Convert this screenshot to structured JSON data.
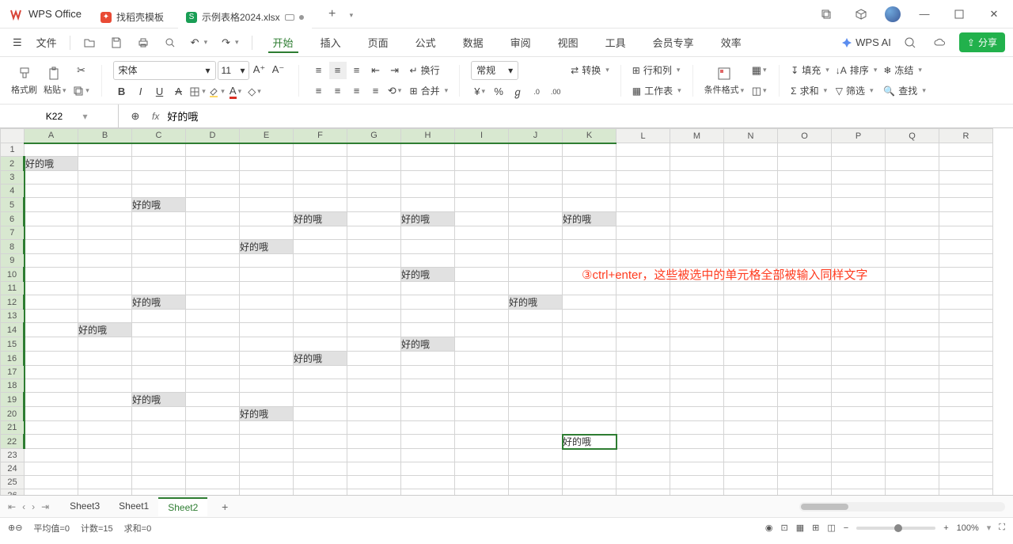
{
  "app": {
    "name": "WPS Office"
  },
  "tabs": {
    "template": "找稻壳模板",
    "file": "示例表格2024.xlsx"
  },
  "menu": {
    "file": "文件",
    "items": [
      "开始",
      "插入",
      "页面",
      "公式",
      "数据",
      "审阅",
      "视图",
      "工具",
      "会员专享",
      "效率"
    ],
    "wps_ai": "WPS AI",
    "share": "分享"
  },
  "ribbon": {
    "format_painter": "格式刷",
    "paste": "粘贴",
    "font": "宋体",
    "size": "11",
    "number_format": "常规",
    "wrap": "换行",
    "merge": "合并",
    "convert": "转换",
    "rowcol": "行和列",
    "worksheet": "工作表",
    "cond_format": "条件格式",
    "fill": "填充",
    "sort": "排序",
    "freeze": "冻结",
    "sum": "求和",
    "filter": "筛选",
    "find": "查找"
  },
  "formula_bar": {
    "cell_ref": "K22",
    "value": "好的哦"
  },
  "columns": [
    "A",
    "B",
    "C",
    "D",
    "E",
    "F",
    "G",
    "H",
    "I",
    "J",
    "K",
    "L",
    "M",
    "N",
    "O",
    "P",
    "Q",
    "R"
  ],
  "selected_cols": [
    "A",
    "B",
    "C",
    "D",
    "E",
    "F",
    "G",
    "H",
    "I",
    "J",
    "K"
  ],
  "selected_rows": [
    2,
    3,
    4,
    5,
    6,
    7,
    8,
    9,
    10,
    11,
    12,
    13,
    14,
    15,
    16,
    17,
    18,
    19,
    20,
    21,
    22
  ],
  "active_cell": "K22",
  "cells": {
    "A2": "好的哦",
    "C5": "好的哦",
    "F6": "好的哦",
    "H6": "好的哦",
    "K6": "好的哦",
    "E8": "好的哦",
    "H10": "好的哦",
    "C12": "好的哦",
    "J12": "好的哦",
    "B14": "好的哦",
    "H15": "好的哦",
    "F16": "好的哦",
    "C19": "好的哦",
    "E20": "好的哦",
    "K22": "好的哦"
  },
  "sel_mark_rows": [
    2,
    5,
    6,
    8,
    10,
    12,
    14,
    15,
    16,
    19,
    20,
    22
  ],
  "annotation": "③ctrl+enter，这些被选中的单元格全部被输入同样文字",
  "sheets": {
    "list": [
      "Sheet3",
      "Sheet1",
      "Sheet2"
    ],
    "active": "Sheet2"
  },
  "statusbar": {
    "avg": "平均值=0",
    "count": "计数=15",
    "sum": "求和=0",
    "zoom": "100%"
  }
}
